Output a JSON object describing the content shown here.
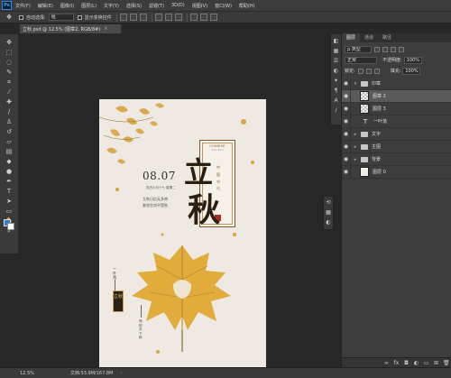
{
  "app": {
    "logo": "Ps",
    "menu": [
      "文件(F)",
      "编辑(E)",
      "图像(I)",
      "图层(L)",
      "文字(Y)",
      "选择(S)",
      "滤镜(T)",
      "3D(D)",
      "视图(V)",
      "窗口(W)",
      "帮助(H)"
    ]
  },
  "options": {
    "auto_select_label": "自动选择:",
    "auto_select_value": "组",
    "transform_label": "显示变换控件"
  },
  "document": {
    "tab_title": "立秋.psd @ 12.5% (图章2, RGB/8#)",
    "tab_close": "×"
  },
  "poster": {
    "date": "08.07",
    "subdate": "农历六月十七 星期二",
    "poem_line1": "立秋日后无多热",
    "poem_line2": "渐觉生凉不是秋",
    "big_char_1": "立",
    "big_char_2": "秋",
    "card_title": "CHINESE",
    "card_sub": "Solar Term",
    "card_col": "中国节气",
    "side_label": "一叶落",
    "badge_text": "立秋",
    "right_col": "而知天下秋"
  },
  "status": {
    "zoom": "12.5%",
    "doc_info": "文档:53.9M/167.8M",
    "arrow": "›"
  },
  "layers_panel": {
    "tabs": [
      "图层",
      "通道",
      "路径"
    ],
    "filter_kind": "ρ 类型",
    "blend_mode": "正常",
    "opacity_label": "不透明度:",
    "opacity_value": "100%",
    "lock_label": "锁定:",
    "fill_label": "填充:",
    "fill_value": "100%",
    "layers": [
      {
        "name": "印章",
        "kind": "group",
        "expanded": true,
        "visible": true
      },
      {
        "name": "图章 2",
        "kind": "pixel",
        "visible": true,
        "selected": true
      },
      {
        "name": "图层 3",
        "kind": "pixel",
        "visible": true
      },
      {
        "name": "一叶落",
        "kind": "text",
        "visible": true
      },
      {
        "name": "文字",
        "kind": "group",
        "visible": true
      },
      {
        "name": "主图",
        "kind": "group",
        "visible": true
      },
      {
        "name": "背景",
        "kind": "group",
        "visible": true
      },
      {
        "name": "图层 0",
        "kind": "pixel",
        "visible": true
      }
    ]
  },
  "colors": {
    "foreground": "#2f7fd6",
    "background": "#ffffff",
    "accent_gold": "#d9a441"
  }
}
